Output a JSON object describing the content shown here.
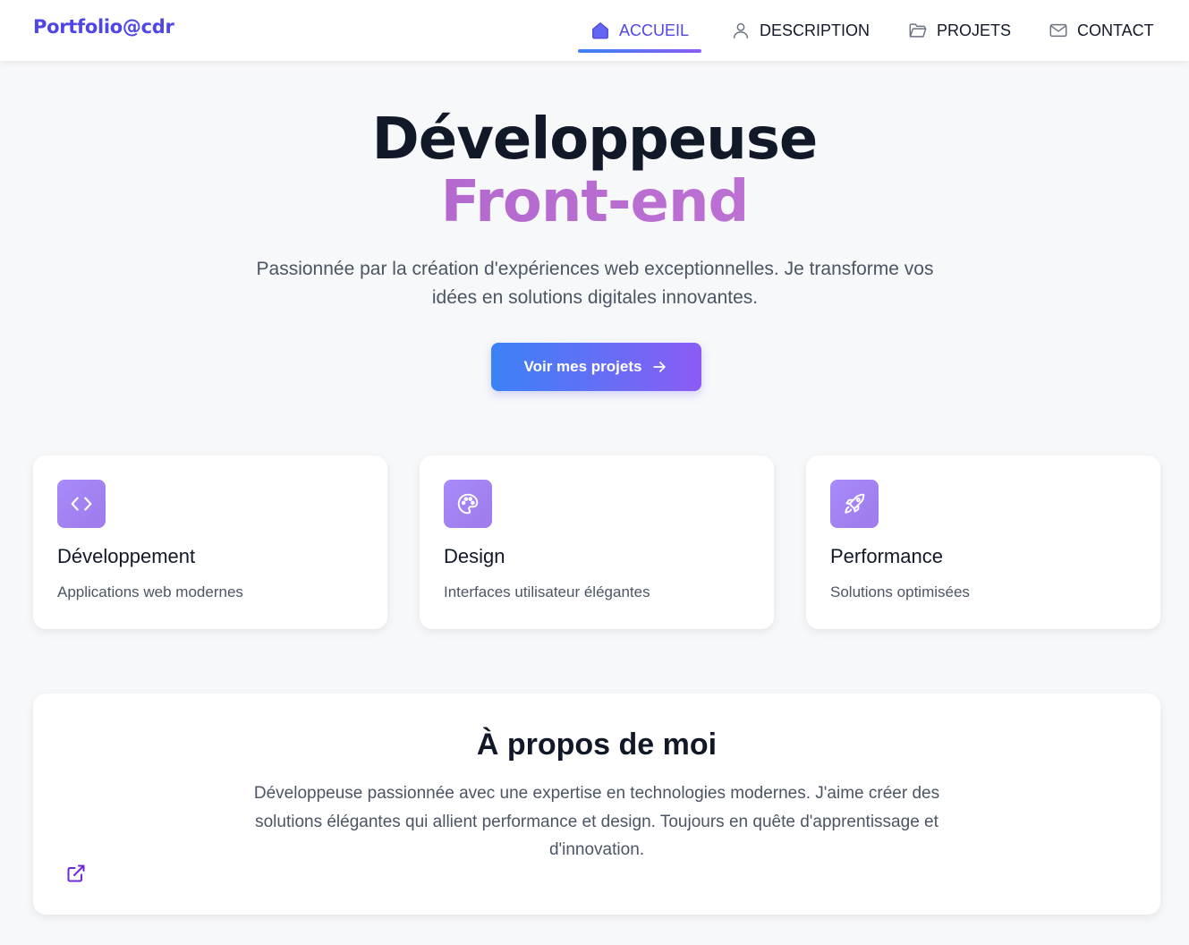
{
  "brand": "Portfolio@cdr",
  "nav": {
    "items": [
      {
        "label": "ACCUEIL",
        "icon": "home-icon",
        "active": true
      },
      {
        "label": "DESCRIPTION",
        "icon": "user-icon",
        "active": false
      },
      {
        "label": "PROJETS",
        "icon": "folder-icon",
        "active": false
      },
      {
        "label": "CONTACT",
        "icon": "mail-icon",
        "active": false
      }
    ]
  },
  "hero": {
    "title": "Développeuse",
    "accent": "Front-end",
    "subtitle": "Passionnée par la création d'expériences web exceptionnelles. Je transforme vos idées en solutions digitales innovantes.",
    "cta_label": "Voir mes projets"
  },
  "cards": [
    {
      "icon": "code-icon",
      "title": "Développement",
      "desc": "Applications web modernes"
    },
    {
      "icon": "palette-icon",
      "title": "Design",
      "desc": "Interfaces utilisateur élégantes"
    },
    {
      "icon": "rocket-icon",
      "title": "Performance",
      "desc": "Solutions optimisées"
    }
  ],
  "about": {
    "title": "À propos de moi",
    "text": "Développeuse passionnée avec une expertise en technologies modernes. J'aime créer des solutions élégantes qui allient performance et design. Toujours en quête d'apprentissage et d'innovation."
  },
  "colors": {
    "brand": "#4f46e5",
    "accent_gradient_start": "#3b82f6",
    "accent_gradient_end": "#8b5cf6",
    "hero_accent": "#b86bd0",
    "icon_bg": "#a78bfa"
  }
}
